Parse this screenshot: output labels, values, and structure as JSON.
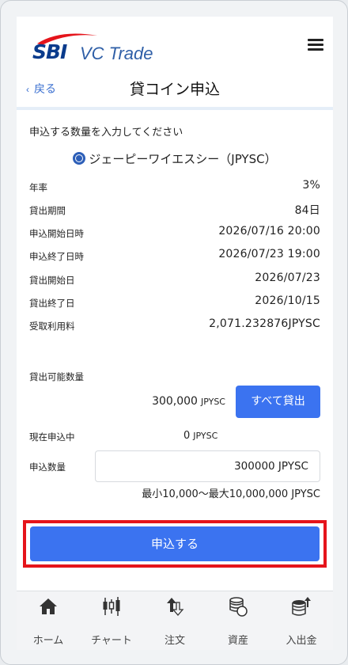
{
  "header": {
    "logo_sbi": "SBI",
    "logo_text": "VC Trade",
    "back_label": "戻る",
    "title": "貸コイン申込"
  },
  "form": {
    "instruction": "申込する数量を入力してください",
    "coin_name": "ジェーピーワイエスシー（JPYSC）",
    "details": [
      {
        "label": "年率",
        "value": "3%"
      },
      {
        "label": "貸出期間",
        "value": "84日"
      },
      {
        "label": "申込開始日時",
        "value": "2026/07/16 20:00"
      },
      {
        "label": "申込終了日時",
        "value": "2026/07/23 19:00"
      },
      {
        "label": "貸出開始日",
        "value": "2026/07/23"
      },
      {
        "label": "貸出終了日",
        "value": "2026/10/15"
      },
      {
        "label": "受取利用料",
        "value": "2,071.232876JPYSC"
      }
    ],
    "available_label": "貸出可能数量",
    "available_value": "300,000",
    "unit": "JPYSC",
    "lend_all_label": "すべて貸出",
    "current_label": "現在申込中",
    "current_value": "0",
    "amount_label": "申込数量",
    "amount_value": "300000 JPYSC",
    "range_text": "最小10,000〜最大10,000,000 JPYSC",
    "submit_label": "申込する"
  },
  "tabs": [
    {
      "label": "ホーム",
      "icon": "home-icon"
    },
    {
      "label": "チャート",
      "icon": "candlestick-chart-icon"
    },
    {
      "label": "注文",
      "icon": "order-arrows-icon"
    },
    {
      "label": "資産",
      "icon": "coins-icon"
    },
    {
      "label": "入出金",
      "icon": "deposit-withdraw-icon"
    }
  ],
  "colors": {
    "accent": "#3b73f0",
    "link": "#3a6fd0",
    "highlight": "#e5141b",
    "logo_navy": "#0a3b8c"
  }
}
